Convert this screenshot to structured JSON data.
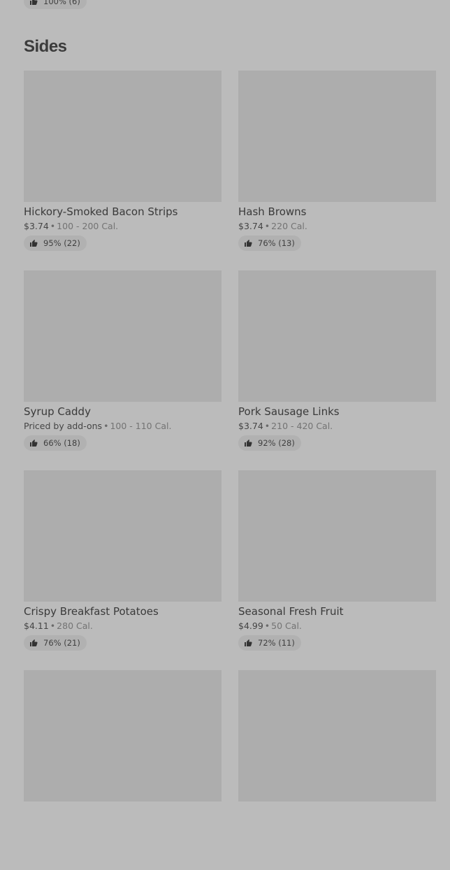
{
  "top_badge": {
    "text": "100% (6)"
  },
  "section": {
    "title": "Sides"
  },
  "items": [
    {
      "name": "Hickory-Smoked Bacon Strips",
      "price": "$3.74",
      "calories": "100 - 200 Cal.",
      "rating": "95% (22)"
    },
    {
      "name": "Hash Browns",
      "price": "$3.74",
      "calories": "220 Cal.",
      "rating": "76% (13)"
    },
    {
      "name": "Syrup Caddy",
      "price": "Priced by add-ons",
      "calories": "100 - 110 Cal.",
      "rating": "66% (18)"
    },
    {
      "name": "Pork Sausage Links",
      "price": "$3.74",
      "calories": "210 - 420 Cal.",
      "rating": "92% (28)"
    },
    {
      "name": "Crispy Breakfast Potatoes",
      "price": "$4.11",
      "calories": "280 Cal.",
      "rating": "76% (21)"
    },
    {
      "name": "Seasonal Fresh Fruit",
      "price": "$4.99",
      "calories": "50 Cal.",
      "rating": "72% (11)"
    },
    {
      "name": "",
      "price": "",
      "calories": "",
      "rating": ""
    },
    {
      "name": "",
      "price": "",
      "calories": "",
      "rating": ""
    }
  ],
  "icons": {
    "rating": "thumbs-up-icon",
    "separator": "•"
  }
}
